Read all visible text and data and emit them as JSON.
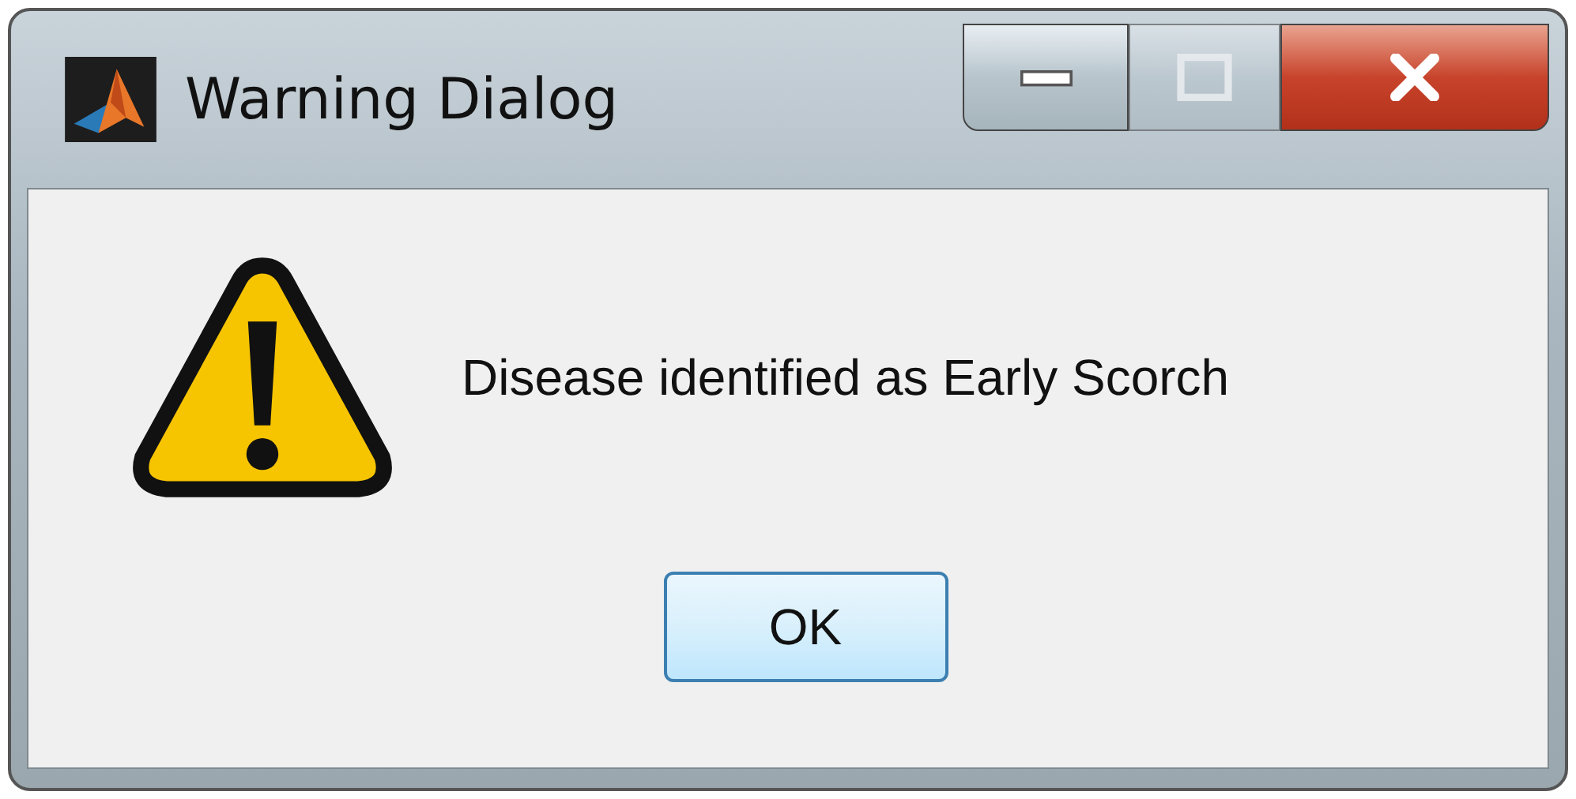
{
  "window": {
    "title": "Warning Dialog"
  },
  "title_buttons": [
    {
      "kind": "minimize",
      "disabled": false
    },
    {
      "kind": "maximize",
      "disabled": true
    },
    {
      "kind": "close",
      "disabled": false
    }
  ],
  "message": "Disease identified as Early Scorch",
  "buttons": [
    "OK"
  ]
}
